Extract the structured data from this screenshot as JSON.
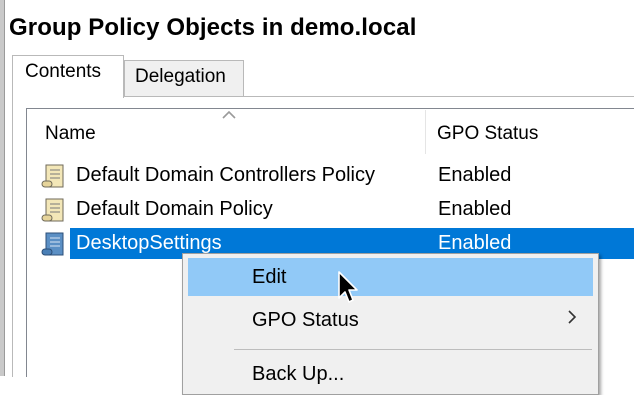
{
  "window": {
    "title": "Group Policy Objects in demo.local"
  },
  "tabs": [
    {
      "label": "Contents",
      "active": true
    },
    {
      "label": "Delegation",
      "active": false
    }
  ],
  "columns": {
    "name": "Name",
    "status": "GPO Status",
    "sorted_by": "Name",
    "sort_direction": "ascending"
  },
  "rows": [
    {
      "name": "Default Domain Controllers Policy",
      "status": "Enabled",
      "selected": false,
      "icon": "gpo-scroll-icon"
    },
    {
      "name": "Default Domain Policy",
      "status": "Enabled",
      "selected": false,
      "icon": "gpo-scroll-icon"
    },
    {
      "name": "DesktopSettings",
      "status": "Enabled",
      "selected": true,
      "icon": "gpo-scroll-icon"
    }
  ],
  "context_menu": {
    "items": [
      {
        "label": "Edit",
        "highlighted": true
      },
      {
        "label": "GPO Status",
        "has_submenu": true
      },
      {
        "label": "Back Up..."
      }
    ]
  },
  "colors": {
    "selection": "#0078d7",
    "menu_highlight": "#91c9f7",
    "menu_bg": "#f0f0f0"
  }
}
